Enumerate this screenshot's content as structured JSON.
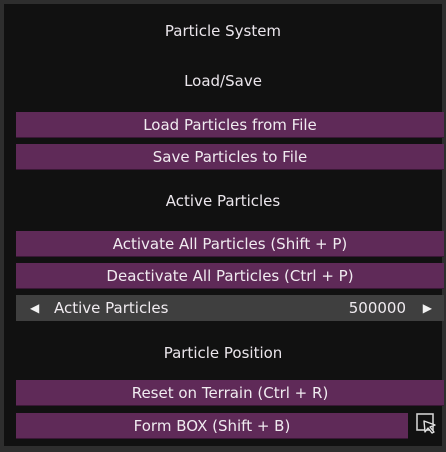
{
  "panel": {
    "title": "Particle System"
  },
  "load_save": {
    "heading": "Load/Save",
    "load_label": "Load Particles from File",
    "save_label": "Save Particles to File"
  },
  "active_particles": {
    "heading": "Active Particles",
    "activate_label": "Activate All Particles (Shift + P)",
    "deactivate_label": "Deactivate All Particles (Ctrl + P)",
    "slider_label": "Active Particles",
    "slider_value": "500000",
    "left_arrow": "◀",
    "right_arrow": "▶"
  },
  "particle_position": {
    "heading": "Particle Position",
    "reset_label": "Reset on Terrain (Ctrl + R)",
    "form_box_label": "Form BOX (Shift + B)",
    "form_box_icon": "cursor-select-icon"
  },
  "colors": {
    "button_bg": "#5f2a58",
    "panel_bg": "#111111",
    "slider_bg": "#3f3f3f"
  }
}
